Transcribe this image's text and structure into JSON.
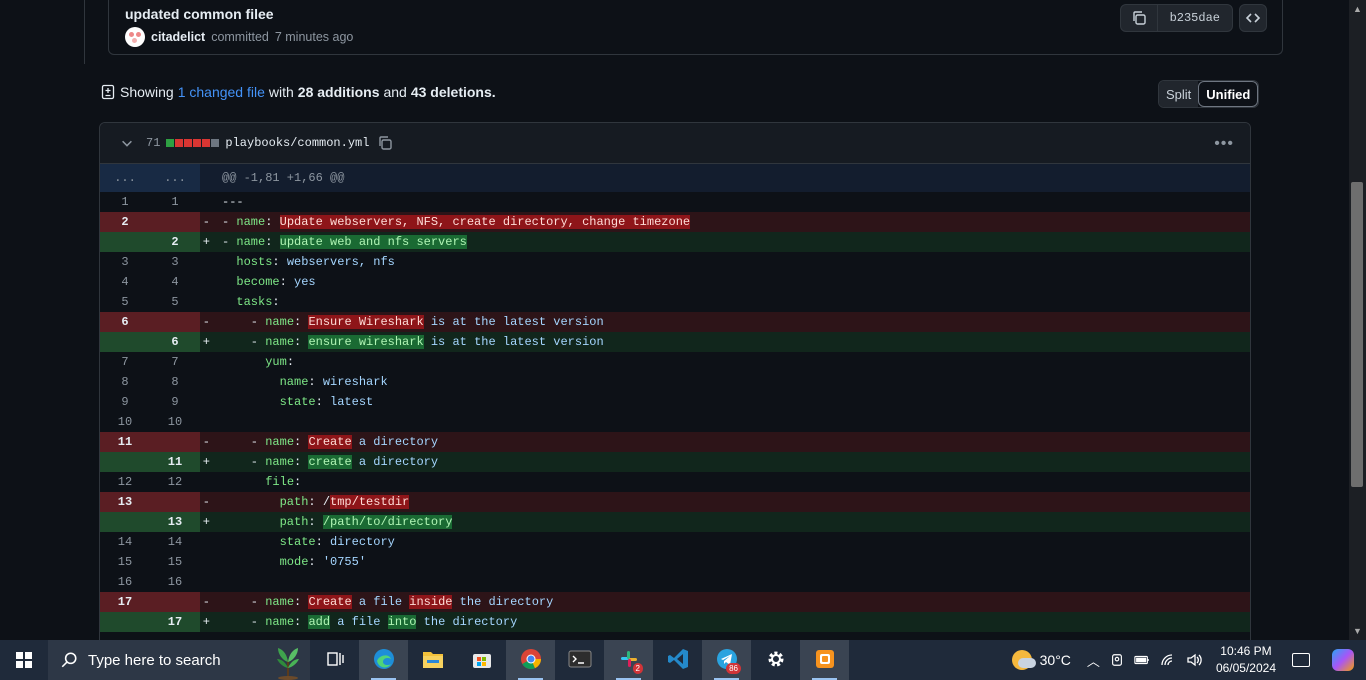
{
  "commit": {
    "title": "updated common filee",
    "author": "citadelict",
    "action": "committed",
    "time": "7 minutes ago",
    "sha": "b235dae"
  },
  "summary": {
    "showing": "Showing",
    "changed_link": "1 changed file",
    "with": "with",
    "additions": "28 additions",
    "and": "and",
    "deletions": "43 deletions."
  },
  "view_toggle": {
    "split": "Split",
    "unified": "Unified",
    "selected": "Unified"
  },
  "file": {
    "change_count": "71",
    "path": "playbooks/common.yml",
    "hunk_header": "@@ -1,81 +1,66 @@",
    "expand_label": "...",
    "diffstat_colors": [
      "#2ea043",
      "#da3633",
      "#da3633",
      "#da3633",
      "#da3633",
      "#6e7681"
    ]
  },
  "diff_lines": [
    {
      "type": "ctx",
      "old": "1",
      "new": "1",
      "mark": "",
      "parts": [
        {
          "t": "---",
          "c": ""
        }
      ]
    },
    {
      "type": "del",
      "old": "2",
      "new": "",
      "mark": "-",
      "parts": [
        {
          "t": "- ",
          "c": ""
        },
        {
          "t": "name",
          "c": "k"
        },
        {
          "t": ": ",
          "c": ""
        },
        {
          "t": "Update webservers, NFS, create directory, change timezone",
          "c": "hl-del"
        }
      ]
    },
    {
      "type": "add",
      "old": "",
      "new": "2",
      "mark": "+",
      "parts": [
        {
          "t": "- ",
          "c": ""
        },
        {
          "t": "name",
          "c": "k"
        },
        {
          "t": ": ",
          "c": ""
        },
        {
          "t": "update web and nfs servers",
          "c": "hl-add"
        }
      ]
    },
    {
      "type": "ctx",
      "old": "3",
      "new": "3",
      "mark": "",
      "parts": [
        {
          "t": "  ",
          "c": ""
        },
        {
          "t": "hosts",
          "c": "k"
        },
        {
          "t": ": ",
          "c": ""
        },
        {
          "t": "webservers, nfs",
          "c": "v"
        }
      ]
    },
    {
      "type": "ctx",
      "old": "4",
      "new": "4",
      "mark": "",
      "parts": [
        {
          "t": "  ",
          "c": ""
        },
        {
          "t": "become",
          "c": "k"
        },
        {
          "t": ": ",
          "c": ""
        },
        {
          "t": "yes",
          "c": "v"
        }
      ]
    },
    {
      "type": "ctx",
      "old": "5",
      "new": "5",
      "mark": "",
      "parts": [
        {
          "t": "  ",
          "c": ""
        },
        {
          "t": "tasks",
          "c": "k"
        },
        {
          "t": ":",
          "c": ""
        }
      ]
    },
    {
      "type": "del",
      "old": "6",
      "new": "",
      "mark": "-",
      "parts": [
        {
          "t": "    - ",
          "c": ""
        },
        {
          "t": "name",
          "c": "k"
        },
        {
          "t": ": ",
          "c": ""
        },
        {
          "t": "Ensure Wireshark",
          "c": "hl-del"
        },
        {
          "t": " is at the latest version",
          "c": "v"
        }
      ]
    },
    {
      "type": "add",
      "old": "",
      "new": "6",
      "mark": "+",
      "parts": [
        {
          "t": "    - ",
          "c": ""
        },
        {
          "t": "name",
          "c": "k"
        },
        {
          "t": ": ",
          "c": ""
        },
        {
          "t": "ensure wireshark",
          "c": "hl-add"
        },
        {
          "t": " is at the latest version",
          "c": "v"
        }
      ]
    },
    {
      "type": "ctx",
      "old": "7",
      "new": "7",
      "mark": "",
      "parts": [
        {
          "t": "      ",
          "c": ""
        },
        {
          "t": "yum",
          "c": "k"
        },
        {
          "t": ":",
          "c": ""
        }
      ]
    },
    {
      "type": "ctx",
      "old": "8",
      "new": "8",
      "mark": "",
      "parts": [
        {
          "t": "        ",
          "c": ""
        },
        {
          "t": "name",
          "c": "k"
        },
        {
          "t": ": ",
          "c": ""
        },
        {
          "t": "wireshark",
          "c": "v"
        }
      ]
    },
    {
      "type": "ctx",
      "old": "9",
      "new": "9",
      "mark": "",
      "parts": [
        {
          "t": "        ",
          "c": ""
        },
        {
          "t": "state",
          "c": "k"
        },
        {
          "t": ": ",
          "c": ""
        },
        {
          "t": "latest",
          "c": "v"
        }
      ]
    },
    {
      "type": "ctx",
      "old": "10",
      "new": "10",
      "mark": "",
      "parts": []
    },
    {
      "type": "del",
      "old": "11",
      "new": "",
      "mark": "-",
      "parts": [
        {
          "t": "    - ",
          "c": ""
        },
        {
          "t": "name",
          "c": "k"
        },
        {
          "t": ": ",
          "c": ""
        },
        {
          "t": "Create",
          "c": "hl-del"
        },
        {
          "t": " a directory",
          "c": "v"
        }
      ]
    },
    {
      "type": "add",
      "old": "",
      "new": "11",
      "mark": "+",
      "parts": [
        {
          "t": "    - ",
          "c": ""
        },
        {
          "t": "name",
          "c": "k"
        },
        {
          "t": ": ",
          "c": ""
        },
        {
          "t": "create",
          "c": "hl-add"
        },
        {
          "t": " a directory",
          "c": "v"
        }
      ]
    },
    {
      "type": "ctx",
      "old": "12",
      "new": "12",
      "mark": "",
      "parts": [
        {
          "t": "      ",
          "c": ""
        },
        {
          "t": "file",
          "c": "k"
        },
        {
          "t": ":",
          "c": ""
        }
      ]
    },
    {
      "type": "del",
      "old": "13",
      "new": "",
      "mark": "-",
      "parts": [
        {
          "t": "        ",
          "c": ""
        },
        {
          "t": "path",
          "c": "k"
        },
        {
          "t": ": /",
          "c": ""
        },
        {
          "t": "tmp/testdir",
          "c": "hl-del"
        }
      ]
    },
    {
      "type": "add",
      "old": "",
      "new": "13",
      "mark": "+",
      "parts": [
        {
          "t": "        ",
          "c": ""
        },
        {
          "t": "path",
          "c": "k"
        },
        {
          "t": ": ",
          "c": ""
        },
        {
          "t": "/path/to/directory",
          "c": "hl-add"
        }
      ]
    },
    {
      "type": "ctx",
      "old": "14",
      "new": "14",
      "mark": "",
      "parts": [
        {
          "t": "        ",
          "c": ""
        },
        {
          "t": "state",
          "c": "k"
        },
        {
          "t": ": ",
          "c": ""
        },
        {
          "t": "directory",
          "c": "v"
        }
      ]
    },
    {
      "type": "ctx",
      "old": "15",
      "new": "15",
      "mark": "",
      "parts": [
        {
          "t": "        ",
          "c": ""
        },
        {
          "t": "mode",
          "c": "k"
        },
        {
          "t": ": ",
          "c": ""
        },
        {
          "t": "'0755'",
          "c": "v"
        }
      ]
    },
    {
      "type": "ctx",
      "old": "16",
      "new": "16",
      "mark": "",
      "parts": []
    },
    {
      "type": "del",
      "old": "17",
      "new": "",
      "mark": "-",
      "parts": [
        {
          "t": "    - ",
          "c": ""
        },
        {
          "t": "name",
          "c": "k"
        },
        {
          "t": ": ",
          "c": ""
        },
        {
          "t": "Create",
          "c": "hl-del"
        },
        {
          "t": " a file ",
          "c": "v"
        },
        {
          "t": "inside",
          "c": "hl-del"
        },
        {
          "t": " the directory",
          "c": "v"
        }
      ]
    },
    {
      "type": "add",
      "old": "",
      "new": "17",
      "mark": "+",
      "parts": [
        {
          "t": "    - ",
          "c": ""
        },
        {
          "t": "name",
          "c": "k"
        },
        {
          "t": ": ",
          "c": ""
        },
        {
          "t": "add",
          "c": "hl-add"
        },
        {
          "t": " a file ",
          "c": "v"
        },
        {
          "t": "into",
          "c": "hl-add"
        },
        {
          "t": " the directory",
          "c": "v"
        }
      ]
    }
  ],
  "taskbar": {
    "search_placeholder": "Type here to search",
    "apps": [
      {
        "name": "task-view-icon",
        "active": false
      },
      {
        "name": "edge-icon",
        "active": true
      },
      {
        "name": "file-explorer-icon",
        "active": false
      },
      {
        "name": "microsoft-store-icon",
        "active": false
      },
      {
        "name": "chrome-icon",
        "active": true
      },
      {
        "name": "terminal-icon",
        "active": false
      },
      {
        "name": "slack-icon",
        "active": true,
        "badge": "2"
      },
      {
        "name": "vscode-icon",
        "active": false
      },
      {
        "name": "telegram-icon",
        "active": true,
        "badge": "86"
      },
      {
        "name": "settings-icon",
        "active": false
      },
      {
        "name": "screen-recorder-icon",
        "active": true
      }
    ],
    "weather": "30°C",
    "time": "10:46 PM",
    "date": "06/05/2024"
  }
}
